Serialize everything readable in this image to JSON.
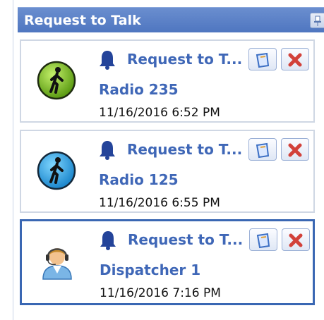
{
  "header": {
    "title": "Request to Talk"
  },
  "cards": [
    {
      "title": "Request to T...",
      "name": "Radio 235",
      "time": "11/16/2016 6:52 PM",
      "avatar_icon": "walking-person-green-icon",
      "avatar_color": "#7cc424"
    },
    {
      "title": "Request to T...",
      "name": "Radio 125",
      "time": "11/16/2016 6:55 PM",
      "avatar_icon": "walking-person-blue-icon",
      "avatar_color": "#2fa6e6"
    },
    {
      "title": "Request to T...",
      "name": "Dispatcher 1",
      "time": "11/16/2016 7:16 PM",
      "avatar_icon": "dispatcher-headset-icon",
      "selected": true
    }
  ],
  "colors": {
    "accent": "#3f67b7",
    "header_bg": "#5a80c8",
    "close_red": "#d2413a"
  }
}
